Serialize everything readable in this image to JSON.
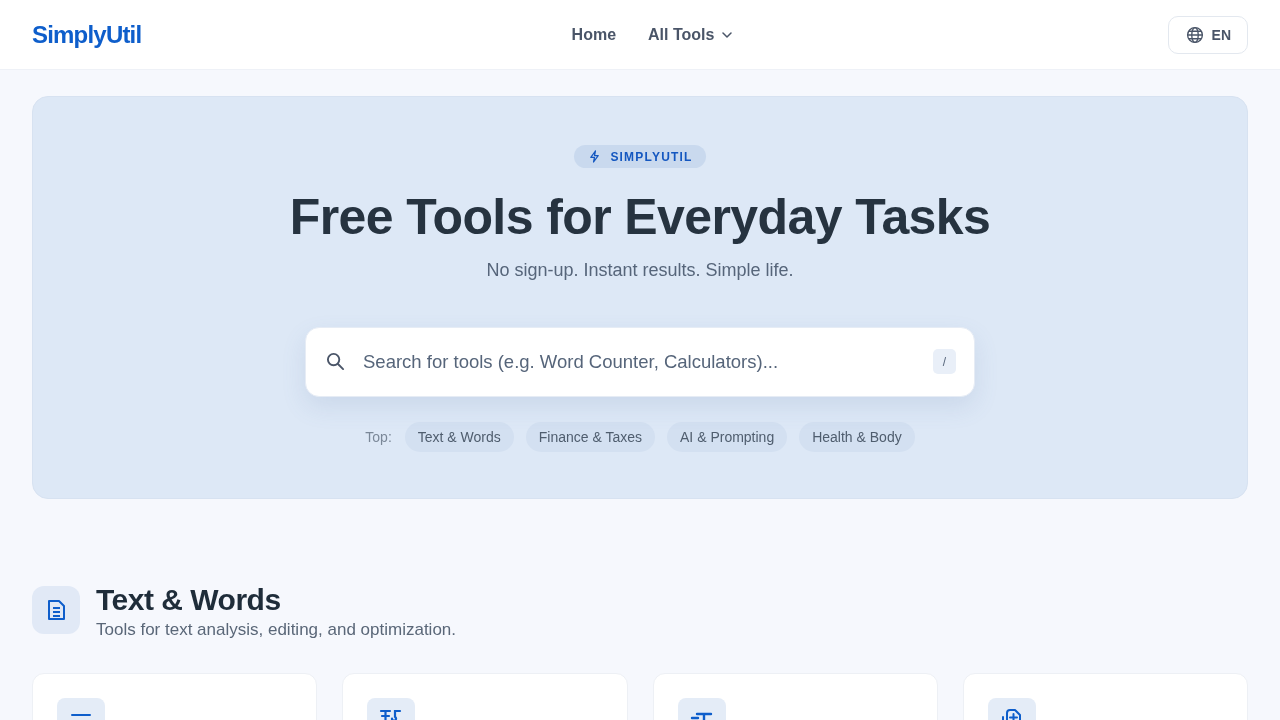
{
  "header": {
    "logo": "SimplyUtil",
    "nav": [
      {
        "label": "Home",
        "dropdown": false
      },
      {
        "label": "All Tools",
        "dropdown": true
      }
    ],
    "language": "EN"
  },
  "hero": {
    "badge": "SIMPLYUTIL",
    "title": "Free Tools for Everyday Tasks",
    "subtitle": "No sign-up. Instant results. Simple life.",
    "search": {
      "placeholder": "Search for tools (e.g. Word Counter, Calculators)...",
      "shortcut": "/"
    },
    "top_label": "Top:",
    "top_categories": [
      "Text & Words",
      "Finance & Taxes",
      "AI & Prompting",
      "Health & Body"
    ]
  },
  "section": {
    "title": "Text & Words",
    "subtitle": "Tools for text analysis, editing, and optimization."
  }
}
